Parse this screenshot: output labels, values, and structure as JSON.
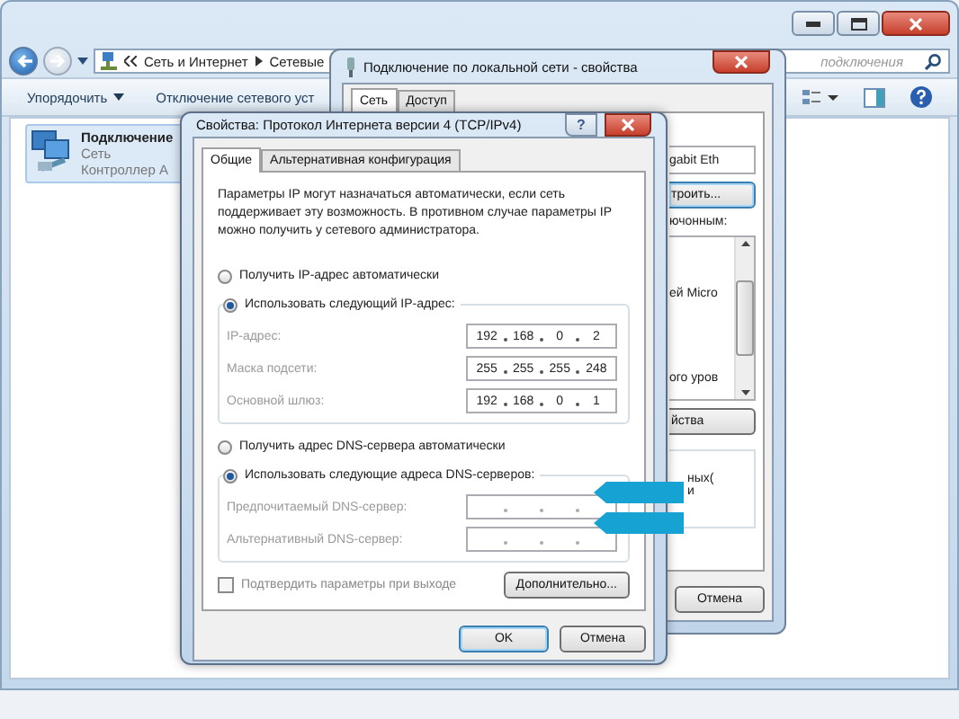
{
  "explorer": {
    "address": {
      "crumbs": [
        "Сеть и Интернет",
        "Сетевые"
      ]
    },
    "search": {
      "placeholder": "подключения"
    },
    "toolbar": [
      {
        "label": "Упорядочить",
        "dropdown": true
      },
      {
        "label": "Отключение сетевого уст",
        "dropdown": false
      }
    ],
    "item": {
      "name": "Подключение",
      "lines": [
        "Сеть",
        "Контроллер A"
      ],
      "selected": true
    }
  },
  "lan_window": {
    "title": "Подключение по локальной сети - свойства",
    "tabs": [
      {
        "label": "Сеть",
        "selected": true
      },
      {
        "label": "Доступ",
        "selected": false
      }
    ],
    "adapter_field": "gabit Eth",
    "configure_button": "троить...",
    "components_label": "ючонным:",
    "components": [
      "ей Micro",
      "ого уров"
    ],
    "properties_button": "йства",
    "description": [
      "ных(",
      "и"
    ],
    "cancel_button": "Отмена"
  },
  "tcp_dialog": {
    "title": "Свойства: Протокол Интернета версии 4 (TCP/IPv4)",
    "help": "?",
    "tabs": [
      {
        "label": "Общие",
        "selected": true
      },
      {
        "label": "Альтернативная конфигурация",
        "selected": false
      }
    ],
    "description": "Параметры IP могут назначаться автоматически, если сеть поддерживает эту возможность. В противном случае параметры IP можно получить у сетевого администратора.",
    "ip_modes": [
      {
        "label": "Получить IP-адрес автоматически",
        "selected": false
      },
      {
        "label": "Использовать следующий IP-адрес:",
        "selected": true
      }
    ],
    "ip_fields": [
      {
        "label": "IP-адрес:",
        "octets": [
          "192",
          "168",
          "0",
          "2"
        ]
      },
      {
        "label": "Маска подсети:",
        "octets": [
          "255",
          "255",
          "255",
          "248"
        ]
      },
      {
        "label": "Основной шлюз:",
        "octets": [
          "192",
          "168",
          "0",
          "1"
        ]
      }
    ],
    "dns_modes": [
      {
        "label": "Получить адрес DNS-сервера автоматически",
        "selected": false
      },
      {
        "label": "Использовать следующие адреса DNS-серверов:",
        "selected": true
      }
    ],
    "dns_fields": [
      {
        "label": "Предпочитаемый DNS-сервер:",
        "highlighted": true
      },
      {
        "label": "Альтернативный DNS-сервер:",
        "highlighted": true
      }
    ],
    "validate": {
      "label": "Подтвердить параметры при выходе",
      "checked": false
    },
    "advanced_button": "Дополнительно...",
    "ok_button": "OK",
    "cancel_button": "Отмена"
  }
}
